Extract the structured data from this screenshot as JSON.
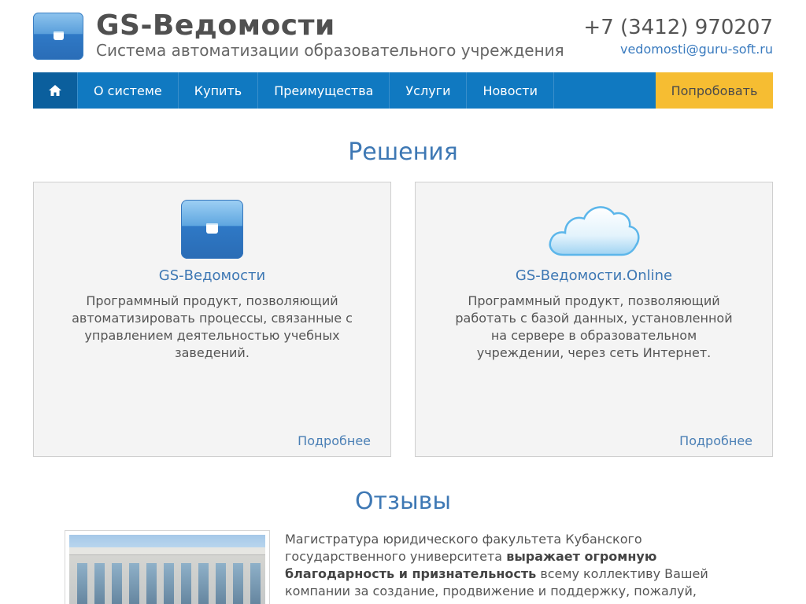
{
  "header": {
    "title": "GS-Ведомости",
    "subtitle": "Система автоматизации образовательного учреждения",
    "phone": "+7 (3412) 970207",
    "email": "vedomosti@guru-soft.ru",
    "logo_icon": "briefcase-icon"
  },
  "nav": {
    "home_icon": "home-icon",
    "items": [
      {
        "label": "О системе"
      },
      {
        "label": "Купить"
      },
      {
        "label": "Преимущества"
      },
      {
        "label": "Услуги"
      },
      {
        "label": "Новости"
      }
    ],
    "try_label": "Попробовать"
  },
  "solutions": {
    "title": "Решения",
    "cards": [
      {
        "icon": "briefcase-icon",
        "name": "GS-Ведомости",
        "description": "Программный продукт, позволяющий автоматизировать процессы, связанные с управлением деятельностью учебных заведений.",
        "more": "Подробнее"
      },
      {
        "icon": "cloud-icon",
        "name": "GS-Ведомости.Online",
        "description": "Программный продукт, позволяющий работать с базой данных, установленной на сервере в образовательном учреждении, через сеть Интернет.",
        "more": "Подробнее"
      }
    ]
  },
  "reviews": {
    "title": "Отзывы",
    "text_before": "Магистратура юридического факультета Кубанского государственного университета ",
    "text_bold": "выражает огромную благодарность и признательность",
    "text_after": " всему коллективу Вашей компании за создание, продвижение и поддержку, пожалуй,"
  },
  "colors": {
    "nav_bg": "#1079c1",
    "nav_home_bg": "#0b5f9d",
    "try_bg": "#f6bd32",
    "accent_text": "#3e78b4"
  }
}
